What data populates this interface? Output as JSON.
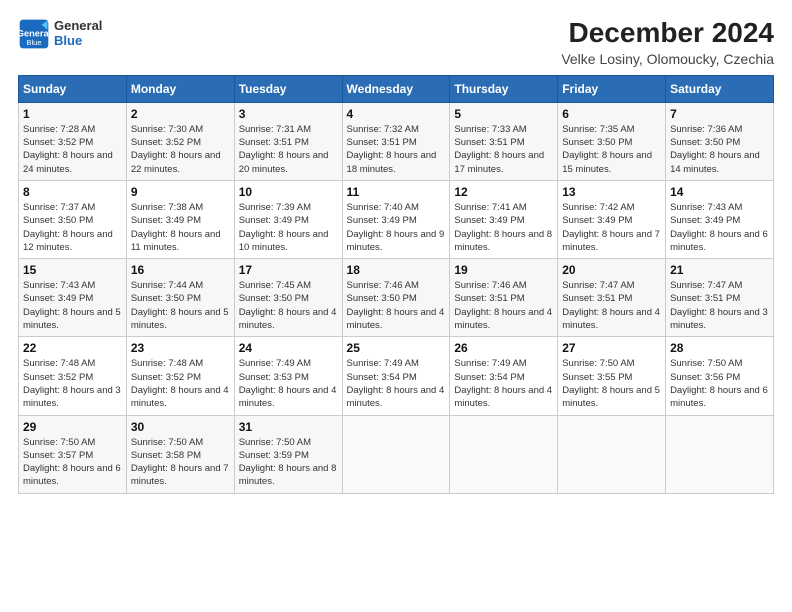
{
  "logo": {
    "line1": "General",
    "line2": "Blue"
  },
  "title": "December 2024",
  "subtitle": "Velke Losiny, Olomoucky, Czechia",
  "weekdays": [
    "Sunday",
    "Monday",
    "Tuesday",
    "Wednesday",
    "Thursday",
    "Friday",
    "Saturday"
  ],
  "weeks": [
    [
      {
        "day": "1",
        "sunrise": "7:28 AM",
        "sunset": "3:52 PM",
        "daylight": "8 hours and 24 minutes."
      },
      {
        "day": "2",
        "sunrise": "7:30 AM",
        "sunset": "3:52 PM",
        "daylight": "8 hours and 22 minutes."
      },
      {
        "day": "3",
        "sunrise": "7:31 AM",
        "sunset": "3:51 PM",
        "daylight": "8 hours and 20 minutes."
      },
      {
        "day": "4",
        "sunrise": "7:32 AM",
        "sunset": "3:51 PM",
        "daylight": "8 hours and 18 minutes."
      },
      {
        "day": "5",
        "sunrise": "7:33 AM",
        "sunset": "3:51 PM",
        "daylight": "8 hours and 17 minutes."
      },
      {
        "day": "6",
        "sunrise": "7:35 AM",
        "sunset": "3:50 PM",
        "daylight": "8 hours and 15 minutes."
      },
      {
        "day": "7",
        "sunrise": "7:36 AM",
        "sunset": "3:50 PM",
        "daylight": "8 hours and 14 minutes."
      }
    ],
    [
      {
        "day": "8",
        "sunrise": "7:37 AM",
        "sunset": "3:50 PM",
        "daylight": "8 hours and 12 minutes."
      },
      {
        "day": "9",
        "sunrise": "7:38 AM",
        "sunset": "3:49 PM",
        "daylight": "8 hours and 11 minutes."
      },
      {
        "day": "10",
        "sunrise": "7:39 AM",
        "sunset": "3:49 PM",
        "daylight": "8 hours and 10 minutes."
      },
      {
        "day": "11",
        "sunrise": "7:40 AM",
        "sunset": "3:49 PM",
        "daylight": "8 hours and 9 minutes."
      },
      {
        "day": "12",
        "sunrise": "7:41 AM",
        "sunset": "3:49 PM",
        "daylight": "8 hours and 8 minutes."
      },
      {
        "day": "13",
        "sunrise": "7:42 AM",
        "sunset": "3:49 PM",
        "daylight": "8 hours and 7 minutes."
      },
      {
        "day": "14",
        "sunrise": "7:43 AM",
        "sunset": "3:49 PM",
        "daylight": "8 hours and 6 minutes."
      }
    ],
    [
      {
        "day": "15",
        "sunrise": "7:43 AM",
        "sunset": "3:49 PM",
        "daylight": "8 hours and 5 minutes."
      },
      {
        "day": "16",
        "sunrise": "7:44 AM",
        "sunset": "3:50 PM",
        "daylight": "8 hours and 5 minutes."
      },
      {
        "day": "17",
        "sunrise": "7:45 AM",
        "sunset": "3:50 PM",
        "daylight": "8 hours and 4 minutes."
      },
      {
        "day": "18",
        "sunrise": "7:46 AM",
        "sunset": "3:50 PM",
        "daylight": "8 hours and 4 minutes."
      },
      {
        "day": "19",
        "sunrise": "7:46 AM",
        "sunset": "3:51 PM",
        "daylight": "8 hours and 4 minutes."
      },
      {
        "day": "20",
        "sunrise": "7:47 AM",
        "sunset": "3:51 PM",
        "daylight": "8 hours and 4 minutes."
      },
      {
        "day": "21",
        "sunrise": "7:47 AM",
        "sunset": "3:51 PM",
        "daylight": "8 hours and 3 minutes."
      }
    ],
    [
      {
        "day": "22",
        "sunrise": "7:48 AM",
        "sunset": "3:52 PM",
        "daylight": "8 hours and 3 minutes."
      },
      {
        "day": "23",
        "sunrise": "7:48 AM",
        "sunset": "3:52 PM",
        "daylight": "8 hours and 4 minutes."
      },
      {
        "day": "24",
        "sunrise": "7:49 AM",
        "sunset": "3:53 PM",
        "daylight": "8 hours and 4 minutes."
      },
      {
        "day": "25",
        "sunrise": "7:49 AM",
        "sunset": "3:54 PM",
        "daylight": "8 hours and 4 minutes."
      },
      {
        "day": "26",
        "sunrise": "7:49 AM",
        "sunset": "3:54 PM",
        "daylight": "8 hours and 4 minutes."
      },
      {
        "day": "27",
        "sunrise": "7:50 AM",
        "sunset": "3:55 PM",
        "daylight": "8 hours and 5 minutes."
      },
      {
        "day": "28",
        "sunrise": "7:50 AM",
        "sunset": "3:56 PM",
        "daylight": "8 hours and 6 minutes."
      }
    ],
    [
      {
        "day": "29",
        "sunrise": "7:50 AM",
        "sunset": "3:57 PM",
        "daylight": "8 hours and 6 minutes."
      },
      {
        "day": "30",
        "sunrise": "7:50 AM",
        "sunset": "3:58 PM",
        "daylight": "8 hours and 7 minutes."
      },
      {
        "day": "31",
        "sunrise": "7:50 AM",
        "sunset": "3:59 PM",
        "daylight": "8 hours and 8 minutes."
      },
      null,
      null,
      null,
      null
    ]
  ]
}
